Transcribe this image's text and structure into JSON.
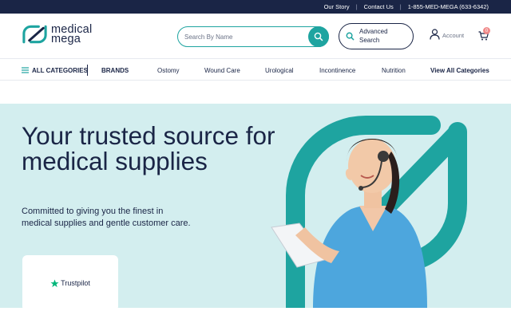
{
  "topbar": {
    "links": [
      "Our Story",
      "Contact Us"
    ],
    "phone": "1-855-MED-MEGA (633-6342)"
  },
  "header": {
    "logo_line1": "medical",
    "logo_line2": "mega",
    "search_placeholder": "Search By Name",
    "advanced_line1": "Advanced",
    "advanced_line2": "Search",
    "account_label": "Account",
    "cart_count": "0"
  },
  "nav": {
    "all_categories": "ALL CATEGORIES",
    "brands": "BRANDS",
    "items": [
      "Ostomy",
      "Wound Care",
      "Urological",
      "Incontinence",
      "Nutrition"
    ],
    "view_all": "View All Categories"
  },
  "hero": {
    "title": "Your trusted source for medical supplies",
    "subtitle": "Committed to giving you the finest in medical supplies and gentle customer care.",
    "trust_label": "Trustpilot"
  },
  "colors": {
    "navy": "#1a2546",
    "teal": "#1ea4a0",
    "hero_bg": "#d3eeef",
    "trustpilot_green": "#00b67a"
  }
}
